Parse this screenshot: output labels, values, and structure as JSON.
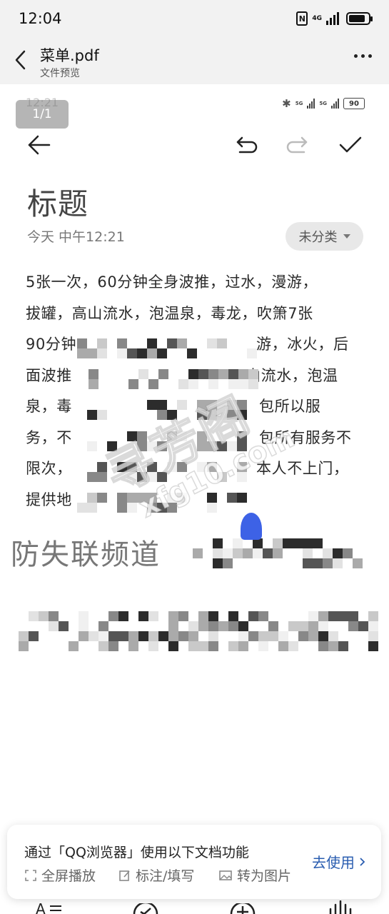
{
  "status_bar": {
    "time": "12:04",
    "network": "4G",
    "battery_level": 0.85
  },
  "header": {
    "title": "菜单.pdf",
    "subtitle": "文件预览"
  },
  "page_indicator": "1/1",
  "note_screenshot": {
    "status_time": "12:21",
    "status_battery": "90",
    "title": "标题",
    "date": "今天 中午12:21",
    "category": "未分类",
    "body_lines": [
      "5张一次，60分钟全身波推，过水，漫游，",
      "拔罐，高山流水，泡温泉，毒龙，吹箫7张",
      "90分钟",
      "面波推",
      "泉，毒",
      "务，不",
      "限次，",
      "提供地"
    ],
    "body_line_tails": [
      "",
      "",
      "游，冰火，后",
      "山流水，泡温",
      "包所以服",
      "包所有服务不",
      "本人不上门，",
      ""
    ],
    "lost_contact_line": "防失联频道"
  },
  "watermark": {
    "main": "寻芳阁",
    "sub": "xfg10.com"
  },
  "banner": {
    "text": "通过「QQ浏览器」使用以下文档功能",
    "features": [
      "全屏播放",
      "标注/填写",
      "转为图片"
    ],
    "cta": "去使用"
  },
  "bottom_toolbar": {
    "icons": [
      "text-format-icon",
      "check-circle-icon",
      "add-circle-icon",
      "audio-wave-icon"
    ]
  }
}
